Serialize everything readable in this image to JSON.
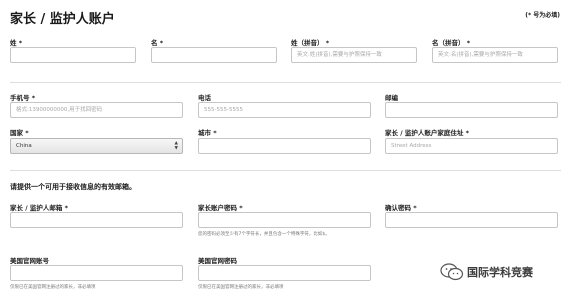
{
  "header": {
    "title": "家长 / 监护人账户",
    "required_note": "(* 号为必填)"
  },
  "name_row": {
    "last_name_label": "姓 *",
    "first_name_label": "名 *",
    "last_name_pinyin_label": "姓（拼音） *",
    "first_name_pinyin_label": "名（拼音） *",
    "last_name_pinyin_placeholder": "英文:姓(拼音),需要与护照保持一致",
    "first_name_pinyin_placeholder": "英文:名(拼音),需要与护照保持一致"
  },
  "contact_row": {
    "mobile_label": "手机号 *",
    "mobile_placeholder": "格式:13900000000,用于找回密码",
    "phone_label": "电话",
    "phone_placeholder": "555-555-5555",
    "postal_label": "邮编"
  },
  "address_row": {
    "country_label": "国家 *",
    "country_value": "China",
    "city_label": "城市 *",
    "address_label": "家长 / 监护人账户家庭住址 *",
    "address_placeholder": "Street Address"
  },
  "email_section": {
    "heading": "请提供一个可用于接收信息的有效邮箱。",
    "email_label": "家长 / 监护人邮箱 *",
    "password_label": "家长账户密码 *",
    "password_help": "您的密码必须至少有7个字符长，并且包含一个特殊字符，比如$。",
    "confirm_label": "确认密码 *"
  },
  "us_account": {
    "account_label": "美国官网账号",
    "account_help": "仅限已在美国官网注册过的家长，非必填项",
    "password_label": "美国官网密码",
    "password_help": "仅限已在美国官网注册过的家长，非必填项"
  },
  "watermark": {
    "text": "国际学科竞赛",
    "icon": "wechat-icon"
  },
  "colors": {
    "border": "#c6c6c6",
    "placeholder": "#a8a8a8",
    "divider": "#dedede"
  }
}
